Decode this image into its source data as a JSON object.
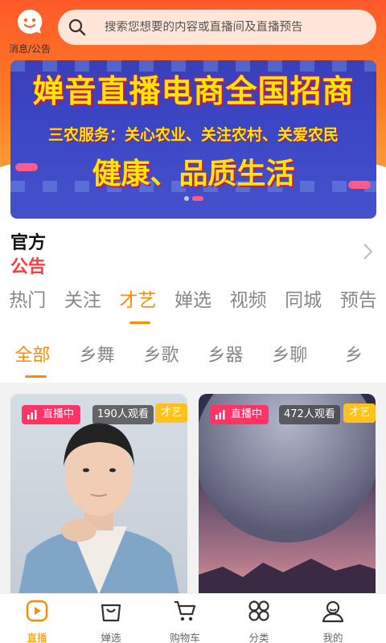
{
  "header": {
    "message_label": "消息/公告",
    "search_placeholder": "搜索您想要的内容或直播间及直播预告"
  },
  "banner": {
    "line1": "婵音直播电商全国招商",
    "line2": "三农服务：关心农业、关注农村、关爱农民",
    "line3": "健康、品质生活",
    "dot_count": 2,
    "active_dot": 1
  },
  "notice": {
    "title_line1": "官方",
    "title_line2": "公告"
  },
  "tabs": [
    {
      "label": "热门"
    },
    {
      "label": "关注"
    },
    {
      "label": "才艺",
      "active": true
    },
    {
      "label": "婵选"
    },
    {
      "label": "视频"
    },
    {
      "label": "同城"
    },
    {
      "label": "预告"
    }
  ],
  "sub_tabs": [
    {
      "label": "全部",
      "active": true
    },
    {
      "label": "乡舞"
    },
    {
      "label": "乡歌"
    },
    {
      "label": "乡器"
    },
    {
      "label": "乡聊"
    },
    {
      "label": "乡"
    }
  ],
  "cards": [
    {
      "live": "直播中",
      "viewers": "190人观看",
      "tag": "才艺"
    },
    {
      "live": "直播中",
      "viewers": "472人观看",
      "tag": "才艺"
    }
  ],
  "bottom_nav": [
    {
      "label": "直播",
      "icon": "play-icon",
      "active": true
    },
    {
      "label": "婵选",
      "icon": "shopping-bag-icon"
    },
    {
      "label": "购物车",
      "icon": "cart-icon"
    },
    {
      "label": "分类",
      "icon": "category-icon"
    },
    {
      "label": "我的",
      "icon": "user-icon"
    }
  ],
  "colors": {
    "accent": "#ff8a00",
    "live_badge": "#ff3366",
    "tag": "#ffc21c",
    "notice_red": "#ff3d3d"
  }
}
